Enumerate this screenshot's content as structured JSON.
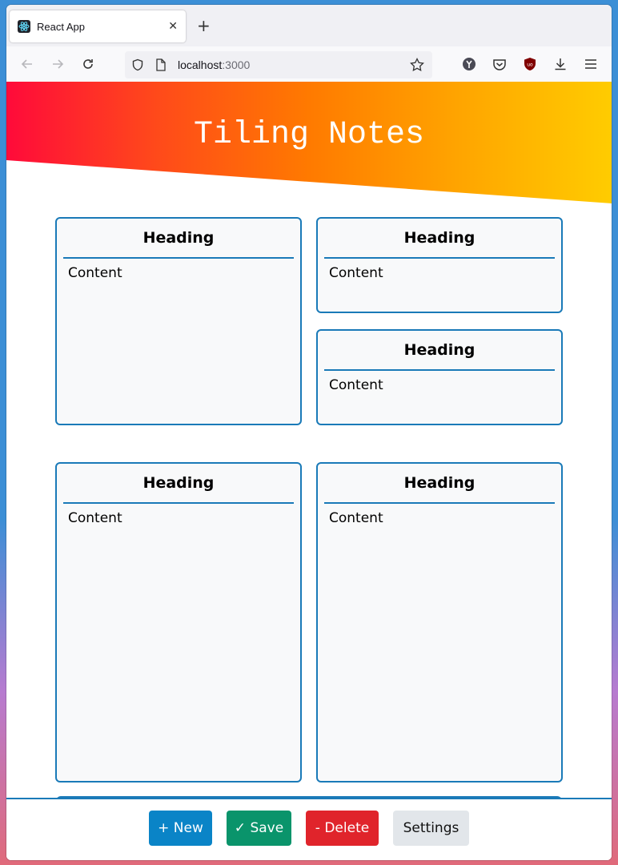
{
  "browser": {
    "tab_title": "React App",
    "new_tab_symbol": "+",
    "url_host": "localhost",
    "url_port": ":3000"
  },
  "header": {
    "title": "Tiling Notes"
  },
  "notes": [
    {
      "heading": "Heading",
      "content": "Content"
    },
    {
      "heading": "Heading",
      "content": "Content"
    },
    {
      "heading": "Heading",
      "content": "Content"
    },
    {
      "heading": "Heading",
      "content": "Content"
    },
    {
      "heading": "Heading",
      "content": "Content"
    }
  ],
  "toolbar": {
    "new_label": "+ New",
    "save_label": "✓ Save",
    "delete_label": "- Delete",
    "settings_label": "Settings"
  },
  "colors": {
    "new": "#0a84c7",
    "save": "#0a946b",
    "delete": "#e0242b",
    "settings": "#e2e6ea",
    "note_border": "#1a7ab8"
  }
}
